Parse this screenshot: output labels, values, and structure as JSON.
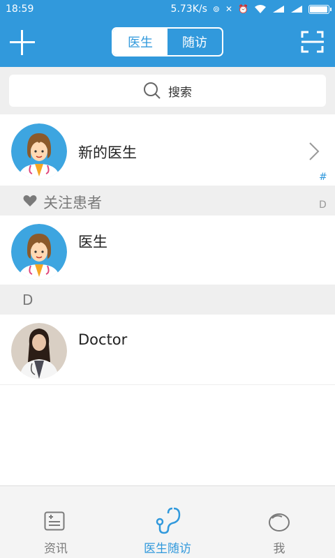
{
  "status_bar": {
    "time": "18:59",
    "network_speed": "5.73K/s",
    "battery_level": 0.9
  },
  "nav": {
    "segments": [
      "医生",
      "随访"
    ],
    "active_segment": "医生"
  },
  "search": {
    "placeholder": "搜索"
  },
  "new_doctor": {
    "label": "新的医生"
  },
  "index_bar": [
    "#",
    "D"
  ],
  "sections": [
    {
      "header": "关注患者",
      "items": [
        {
          "name": "医生"
        }
      ]
    },
    {
      "header": "D",
      "items": [
        {
          "name": "Doctor"
        }
      ]
    }
  ],
  "tabs": [
    {
      "label": "资讯",
      "icon": "news-icon",
      "active": false
    },
    {
      "label": "医生随访",
      "icon": "stethoscope-icon",
      "active": true
    },
    {
      "label": "我",
      "icon": "me-icon",
      "active": false
    }
  ],
  "colors": {
    "primary": "#3199dc",
    "section_bg": "#efefef",
    "tab_inactive": "#7a7a7a"
  }
}
